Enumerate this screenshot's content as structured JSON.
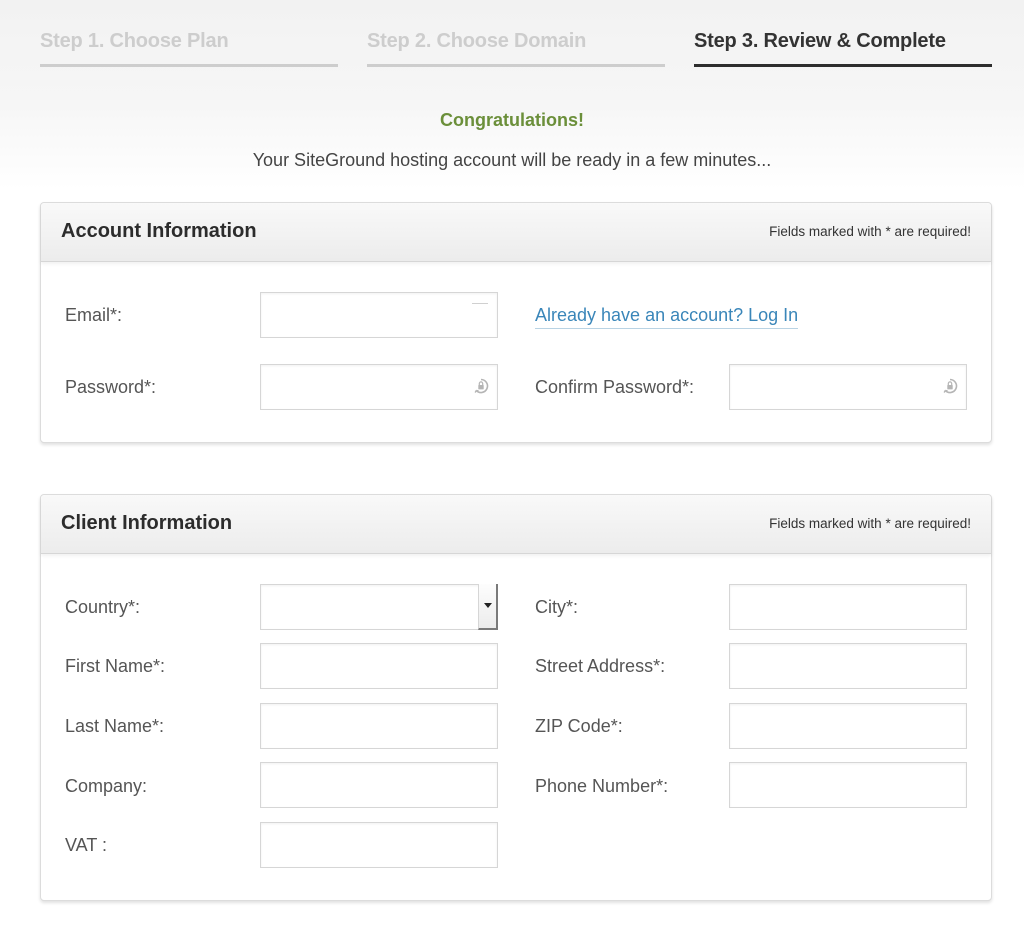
{
  "steps": [
    {
      "label": "Step 1. Choose Plan",
      "active": false
    },
    {
      "label": "Step 2. Choose Domain",
      "active": false
    },
    {
      "label": "Step 3. Review & Complete",
      "active": true
    }
  ],
  "banner": {
    "title": "Congratulations!",
    "message": "Your SiteGround hosting account will be ready in a few minutes..."
  },
  "colors": {
    "accent_green": "#6b8f3a",
    "link_blue": "#3a86b9",
    "active_step": "#2d2d2d",
    "inactive_step": "#cdcdcd"
  },
  "account": {
    "title": "Account Information",
    "note": "Fields marked with * are required!",
    "email_label": "Email*:",
    "email_value": "",
    "login_link": "Already have an account? Log In",
    "password_label": "Password*:",
    "password_value": "",
    "confirm_label": "Confirm Password*:",
    "confirm_value": "",
    "password_icon": "password-manager-lock-icon"
  },
  "client": {
    "title": "Client Information",
    "note": "Fields marked with * are required!",
    "country_label": "Country*:",
    "country_value": "",
    "first_name_label": "First Name*:",
    "first_name_value": "",
    "last_name_label": "Last Name*:",
    "last_name_value": "",
    "company_label": "Company:",
    "company_value": "",
    "vat_label": "VAT :",
    "vat_value": "",
    "city_label": "City*:",
    "city_value": "",
    "street_label": "Street Address*:",
    "street_value": "",
    "zip_label": "ZIP Code*:",
    "zip_value": "",
    "phone_label": "Phone Number*:",
    "phone_value": ""
  }
}
